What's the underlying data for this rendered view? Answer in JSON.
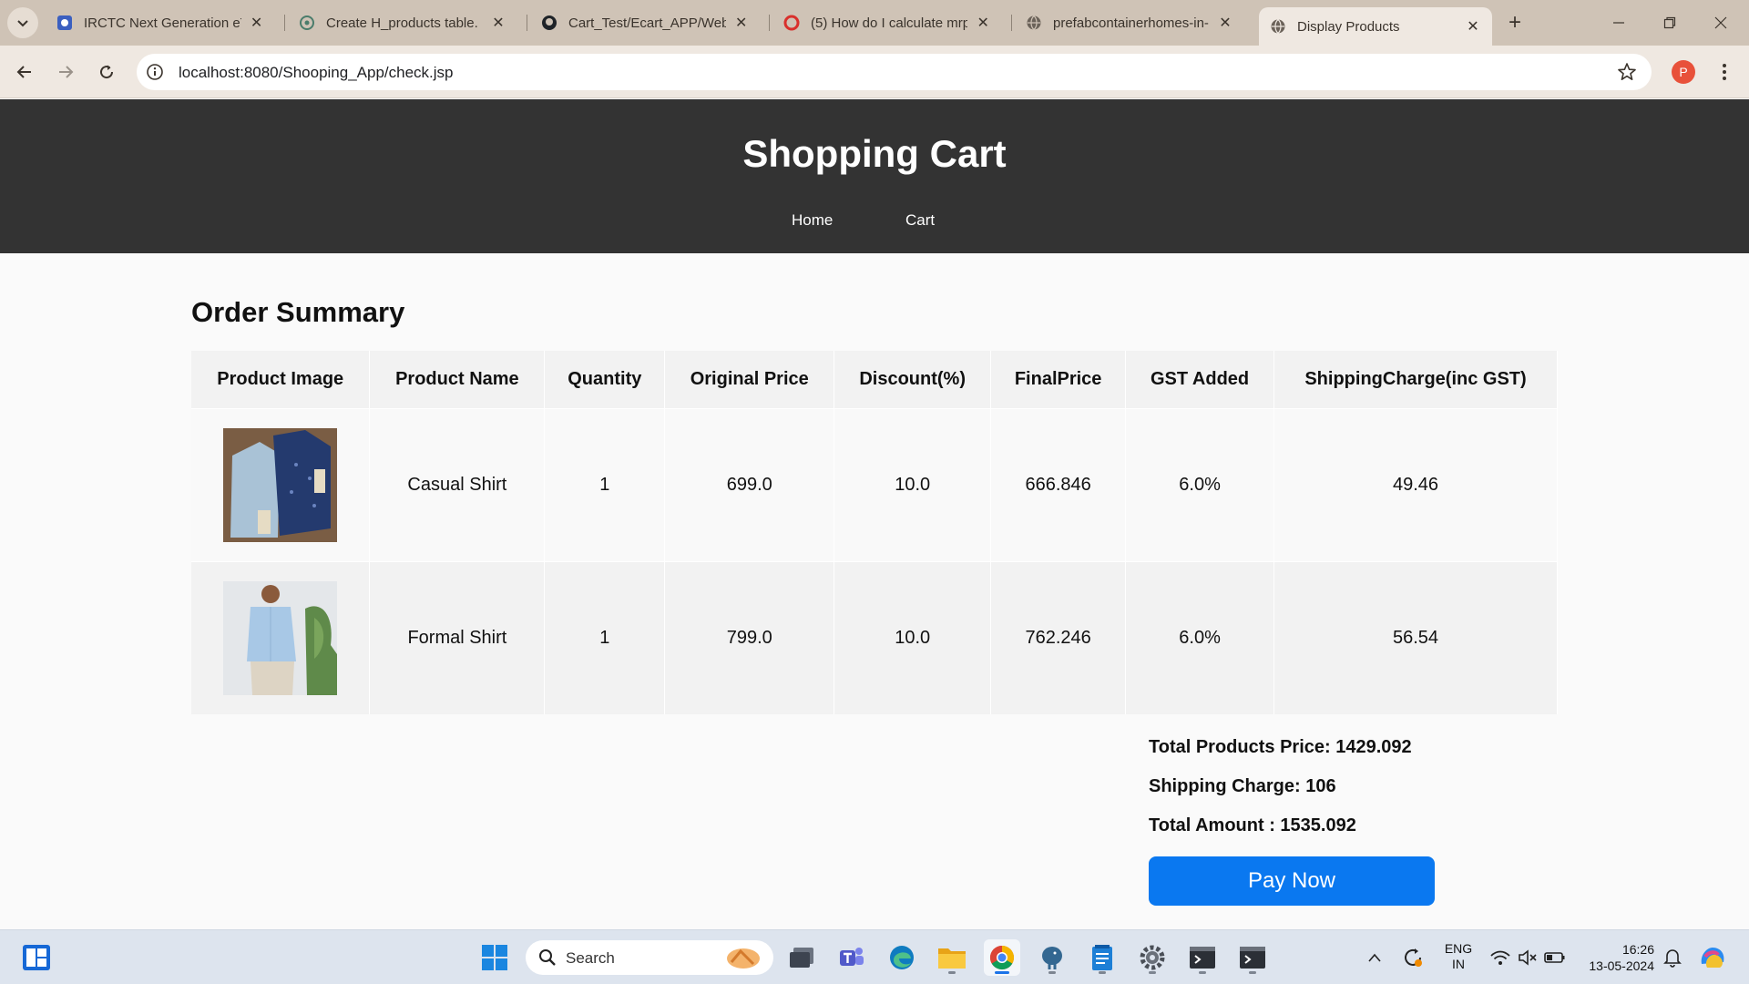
{
  "browser": {
    "tabs": [
      {
        "title": "IRCTC Next Generation eTi",
        "favicon": "irctc-icon"
      },
      {
        "title": "Create H_products table.",
        "favicon": "chatgpt-icon"
      },
      {
        "title": "Cart_Test/Ecart_APP/WebC",
        "favicon": "github-icon"
      },
      {
        "title": "(5) How do I calculate mrp",
        "favicon": "quora-icon"
      },
      {
        "title": "prefabcontainerhomes-in-",
        "favicon": "globe-icon"
      },
      {
        "title": "Display Products",
        "favicon": "globe-icon",
        "active": true
      }
    ],
    "url": "localhost:8080/Shooping_App/check.jsp",
    "profile_initial": "P"
  },
  "header": {
    "title": "Shopping Cart",
    "nav": [
      "Home",
      "Cart"
    ]
  },
  "order": {
    "heading": "Order Summary",
    "columns": [
      "Product Image",
      "Product Name",
      "Quantity",
      "Original Price",
      "Discount(%)",
      "FinalPrice",
      "GST Added",
      "ShippingCharge(inc GST)"
    ],
    "rows": [
      {
        "image": "casual-shirt-image",
        "name": "Casual Shirt",
        "quantity": "1",
        "original_price": "699.0",
        "discount": "10.0",
        "final_price": "666.846",
        "gst": "6.0%",
        "shipping": "49.46"
      },
      {
        "image": "formal-shirt-image",
        "name": "Formal Shirt",
        "quantity": "1",
        "original_price": "799.0",
        "discount": "10.0",
        "final_price": "762.246",
        "gst": "6.0%",
        "shipping": "56.54"
      }
    ],
    "totals": {
      "products_price": "Total Products Price: 1429.092",
      "shipping_charge": "Shipping Charge: 106",
      "total_amount": "Total Amount : 1535.092"
    },
    "pay_label": "Pay Now"
  },
  "taskbar": {
    "search_label": "Search",
    "lang_line1": "ENG",
    "lang_line2": "IN",
    "time": "16:26",
    "date": "13-05-2024"
  },
  "colors": {
    "header_bg": "#333333",
    "pay_button": "#0a78f0",
    "tabstrip": "#cfc3b6"
  }
}
